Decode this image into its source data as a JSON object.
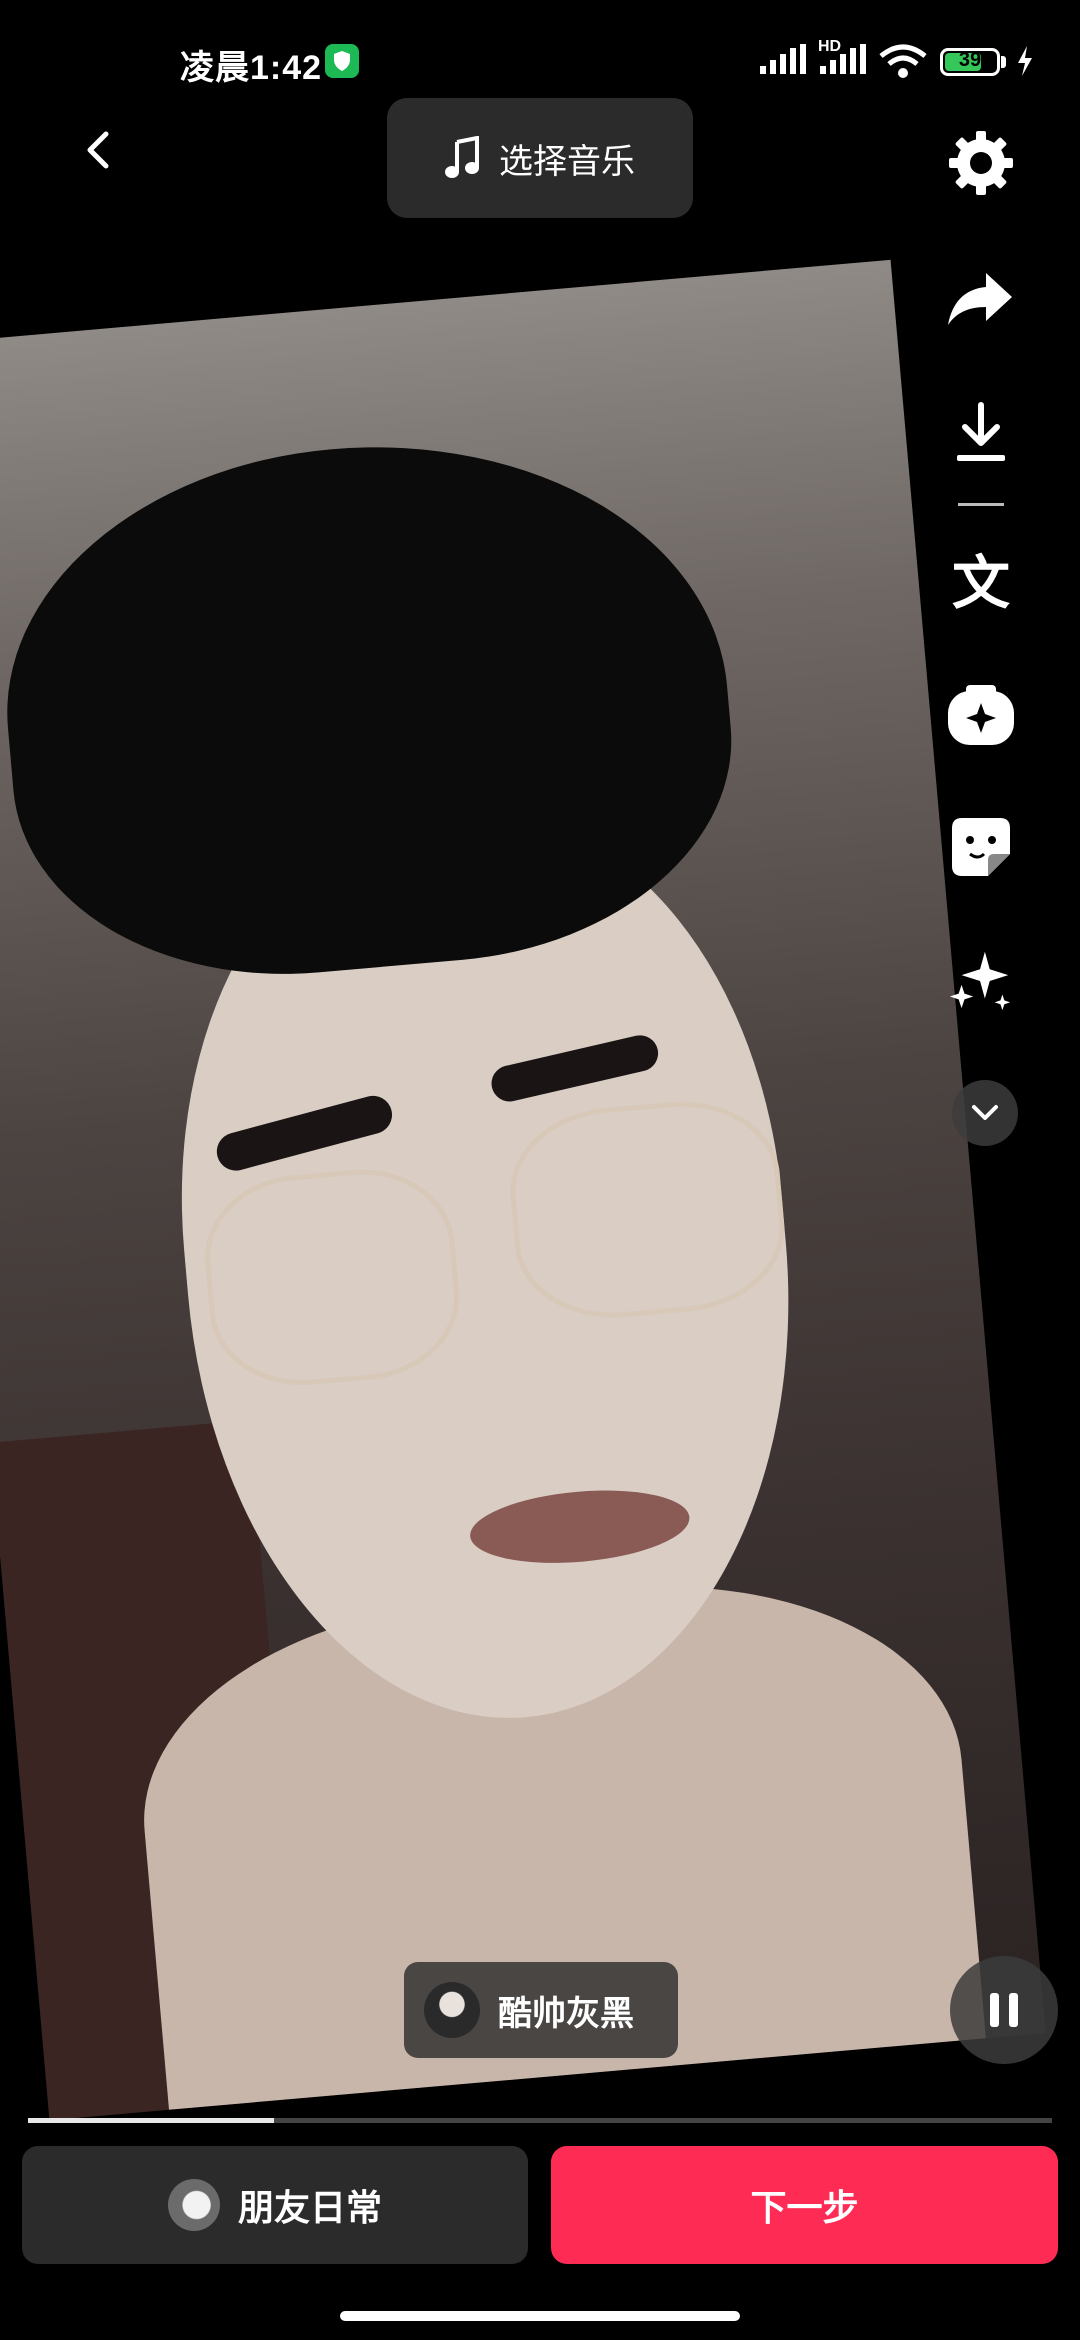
{
  "status_bar": {
    "time": "凌晨1:42",
    "network_badge": "HD",
    "battery_level": "39"
  },
  "header": {
    "back_icon": "chevron-left-icon",
    "music_button_label": "选择音乐",
    "music_icon": "music-note-icon"
  },
  "toolbar": {
    "icons": [
      "gear-icon",
      "share-arrow-icon",
      "download-icon",
      "text-icon",
      "sticker-add-icon",
      "sticker-icon",
      "sparkle-effects-icon",
      "chevron-down-icon"
    ]
  },
  "video": {
    "author_name": "酷帅灰黑",
    "progress": 0.24
  },
  "bottom": {
    "daily_label": "朋友日常",
    "next_label": "下一步"
  },
  "colors": {
    "accent": "#fe2c55",
    "background": "#000000",
    "button_dark": "#2b2b2b"
  }
}
